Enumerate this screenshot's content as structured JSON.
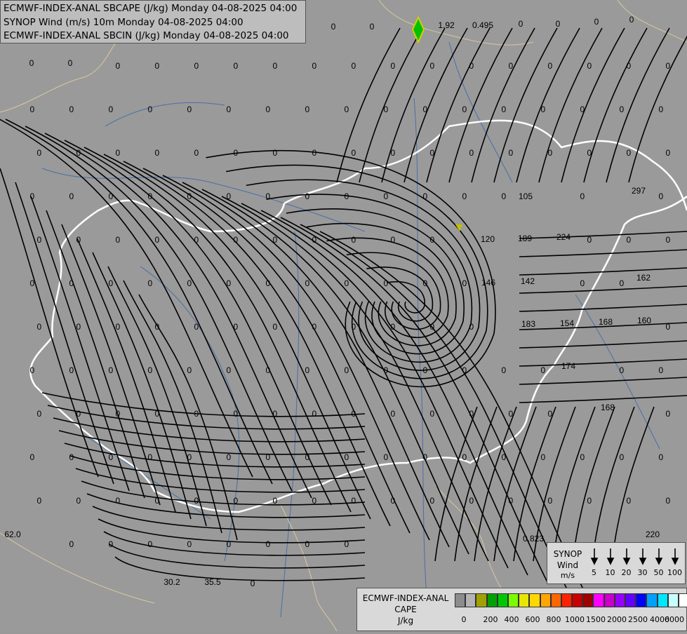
{
  "header": {
    "line1": "ECMWF-INDEX-ANAL SBCAPE (J/kg) Monday 04-08-2025 04:00",
    "line2": "SYNOP Wind (m/s) 10m Monday 04-08-2025 04:00",
    "line3": "ECMWF-INDEX-ANAL SBCIN (J/kg) Monday 04-08-2025 04:00"
  },
  "wind_legend": {
    "title_line1": "SYNOP",
    "title_line2": "Wind",
    "units": "m/s",
    "speeds": [
      "5",
      "10",
      "20",
      "30",
      "50",
      "100"
    ]
  },
  "cape_legend": {
    "title_line1": "ECMWF-INDEX-ANAL",
    "title_line2": "CAPE",
    "units": "J/kg",
    "colors": [
      "#8c8c8c",
      "#b4b4b4",
      "#a0a000",
      "#00a000",
      "#00c800",
      "#7cfc00",
      "#e6e600",
      "#ffd700",
      "#ffa500",
      "#ff6600",
      "#ff2200",
      "#c80000",
      "#a00000",
      "#ff00ff",
      "#c800c8",
      "#9600ff",
      "#6400ff",
      "#0000ff",
      "#00a0ff",
      "#00e6ff",
      "#c8ffff",
      "#ffffff"
    ],
    "ticks": [
      "0",
      "200",
      "400",
      "600",
      "800",
      "1000",
      "1500",
      "2000",
      "2500",
      "4000",
      "6000"
    ]
  },
  "map_labels": [
    {
      "t": "0"
    },
    {
      "t": "0"
    },
    {
      "t": "1.92"
    },
    {
      "t": "0.495"
    },
    {
      "t": "0"
    },
    {
      "t": "0"
    },
    {
      "t": "0"
    },
    {
      "t": "0"
    },
    {
      "t": "0"
    },
    {
      "t": "0"
    },
    {
      "t": "105"
    },
    {
      "t": "297"
    },
    {
      "t": "120"
    },
    {
      "t": "189"
    },
    {
      "t": "224"
    },
    {
      "t": "146"
    },
    {
      "t": "142"
    },
    {
      "t": "162"
    },
    {
      "t": "183"
    },
    {
      "t": "154"
    },
    {
      "t": "168"
    },
    {
      "t": "160"
    },
    {
      "t": "174"
    },
    {
      "t": "168"
    },
    {
      "t": "62.0"
    },
    {
      "t": "0.823"
    },
    {
      "t": "220"
    },
    {
      "t": "30.2"
    },
    {
      "t": "35.5"
    },
    {
      "t": "0"
    }
  ],
  "colors": {
    "background": "#9a9a9a",
    "streamline": "#000000",
    "border": "#ffffff",
    "river": "#4a6fa5"
  }
}
